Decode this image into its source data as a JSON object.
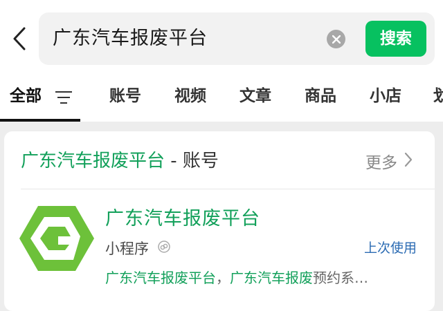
{
  "search": {
    "query": "广东汽车报废平台",
    "button_label": "搜索"
  },
  "tabs": [
    {
      "label": "全部"
    },
    {
      "label": "账号"
    },
    {
      "label": "视频"
    },
    {
      "label": "文章"
    },
    {
      "label": "商品"
    },
    {
      "label": "小店"
    },
    {
      "label": "划"
    }
  ],
  "section": {
    "title_highlight": "广东汽车报废平台",
    "title_suffix": " - 账号",
    "more_label": "更多"
  },
  "result": {
    "title": "广东汽车报废平台",
    "type": "小程序",
    "recent_label": "上次使用",
    "desc_hl1": "广东汽车报废平台",
    "desc_sep": "，",
    "desc_hl2": "广东汽车报废",
    "desc_rest": "预约系…"
  },
  "colors": {
    "accent": "#07c160",
    "highlight": "#12a05a",
    "link": "#2b6bb3"
  }
}
